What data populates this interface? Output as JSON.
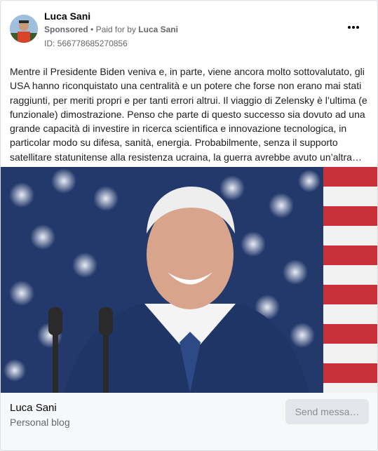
{
  "post": {
    "author": "Luca Sani",
    "sponsored_label": "Sponsored",
    "separator": "•",
    "paid_for_prefix": "Paid for by",
    "paid_for_name": "Luca Sani",
    "ad_id": "ID: 566778685270856",
    "more_icon": "ellipsis-icon",
    "text": "Mentre il Presidente Biden veniva e, in parte, viene ancora molto sottovalutato, gli USA hanno riconquistato una centralità e un potere che forse non erano mai stati raggiunti, per meriti propri e per tanti errori altrui. Il viaggio di Zelensky è l’ultima (e funzionale) dimostrazione. Penso che parte di questo successo sia dovuto ad una grande capacità di investire in ricerca scientifica e innovazione tecnologica, in particolar modo su difesa, sanità, energia. Probabilmente, senza il supporto satellitare statunitense alla resistenza ucraina, la guerra avrebbe avuto un’altra…"
  },
  "footer": {
    "page_name": "Luca Sani",
    "page_category": "Personal blog",
    "send_button": "Send messa…"
  },
  "colors": {
    "flag_blue": "#253a6e",
    "flag_red": "#c8303a",
    "button_bg": "#e4e6eb"
  }
}
